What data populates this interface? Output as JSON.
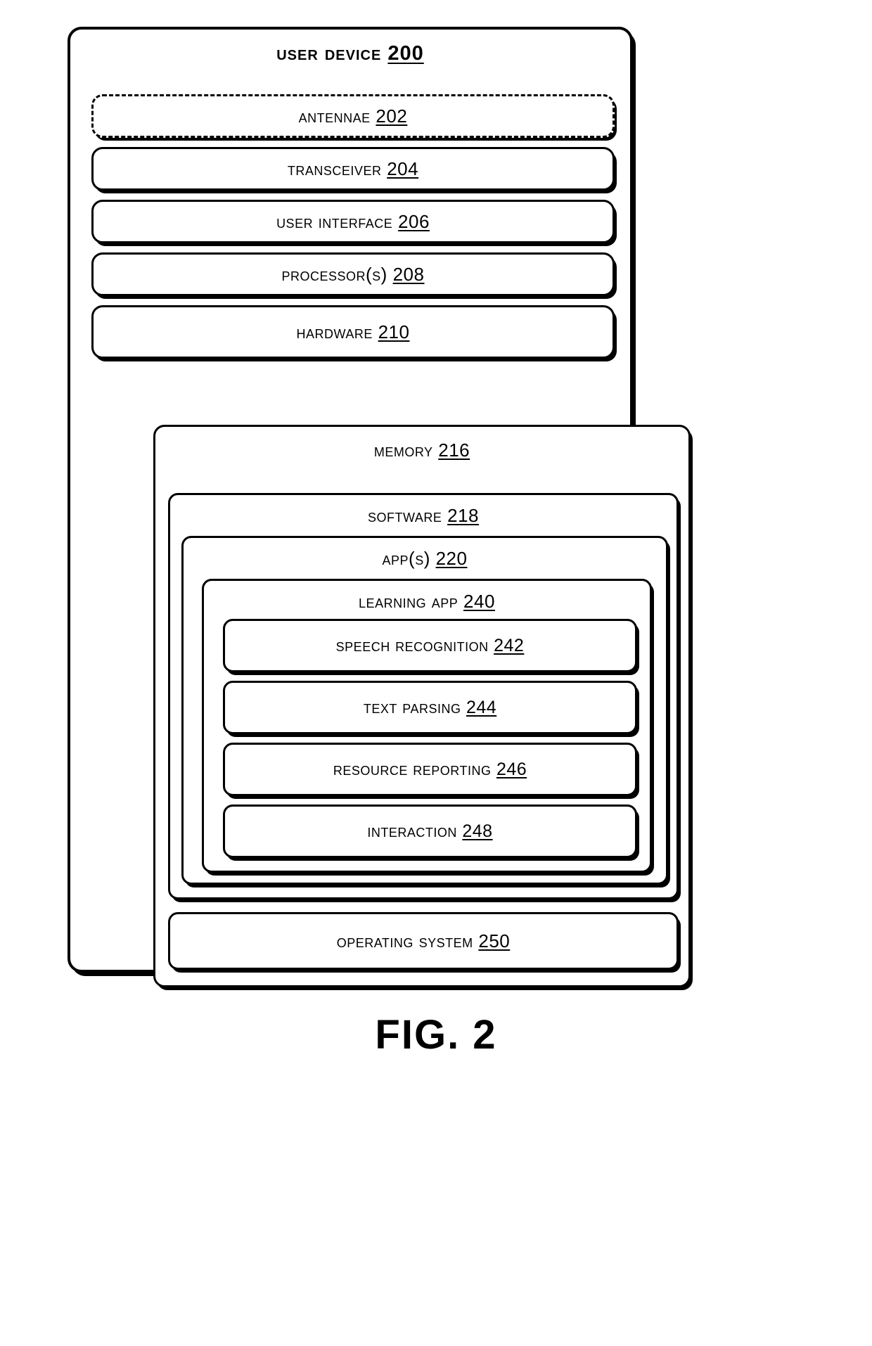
{
  "figure": {
    "caption": "FIG. 2",
    "title": {
      "label": "User Device",
      "ref": "200"
    }
  },
  "components": [
    {
      "name": "antennae",
      "label": "Antennae",
      "ref": "202",
      "border": "dashed"
    },
    {
      "name": "transceiver",
      "label": "Transceiver",
      "ref": "204",
      "border": "solid"
    },
    {
      "name": "user-interface",
      "label": "User Interface",
      "ref": "206",
      "border": "solid"
    },
    {
      "name": "processors",
      "label": "Processor(s)",
      "ref": "208",
      "border": "solid"
    },
    {
      "name": "hardware",
      "label": "Hardware",
      "ref": "210",
      "border": "solid"
    }
  ],
  "memory": {
    "label": "Memory",
    "ref": "216",
    "software": {
      "label": "Software",
      "ref": "218",
      "apps": {
        "label": "App(s)",
        "ref": "220",
        "learning_app": {
          "label": "Learning App",
          "ref": "240",
          "modules": [
            {
              "name": "speech-recognition",
              "label": "Speech Recognition",
              "ref": "242"
            },
            {
              "name": "text-parsing",
              "label": "Text Parsing",
              "ref": "244"
            },
            {
              "name": "resource-reporting",
              "label": "Resource Reporting",
              "ref": "246"
            },
            {
              "name": "interaction",
              "label": "Interaction",
              "ref": "248"
            }
          ]
        }
      }
    },
    "operating_system": {
      "label": "Operating System",
      "ref": "250"
    }
  },
  "colors": {
    "line": "#000000",
    "background": "#ffffff"
  }
}
